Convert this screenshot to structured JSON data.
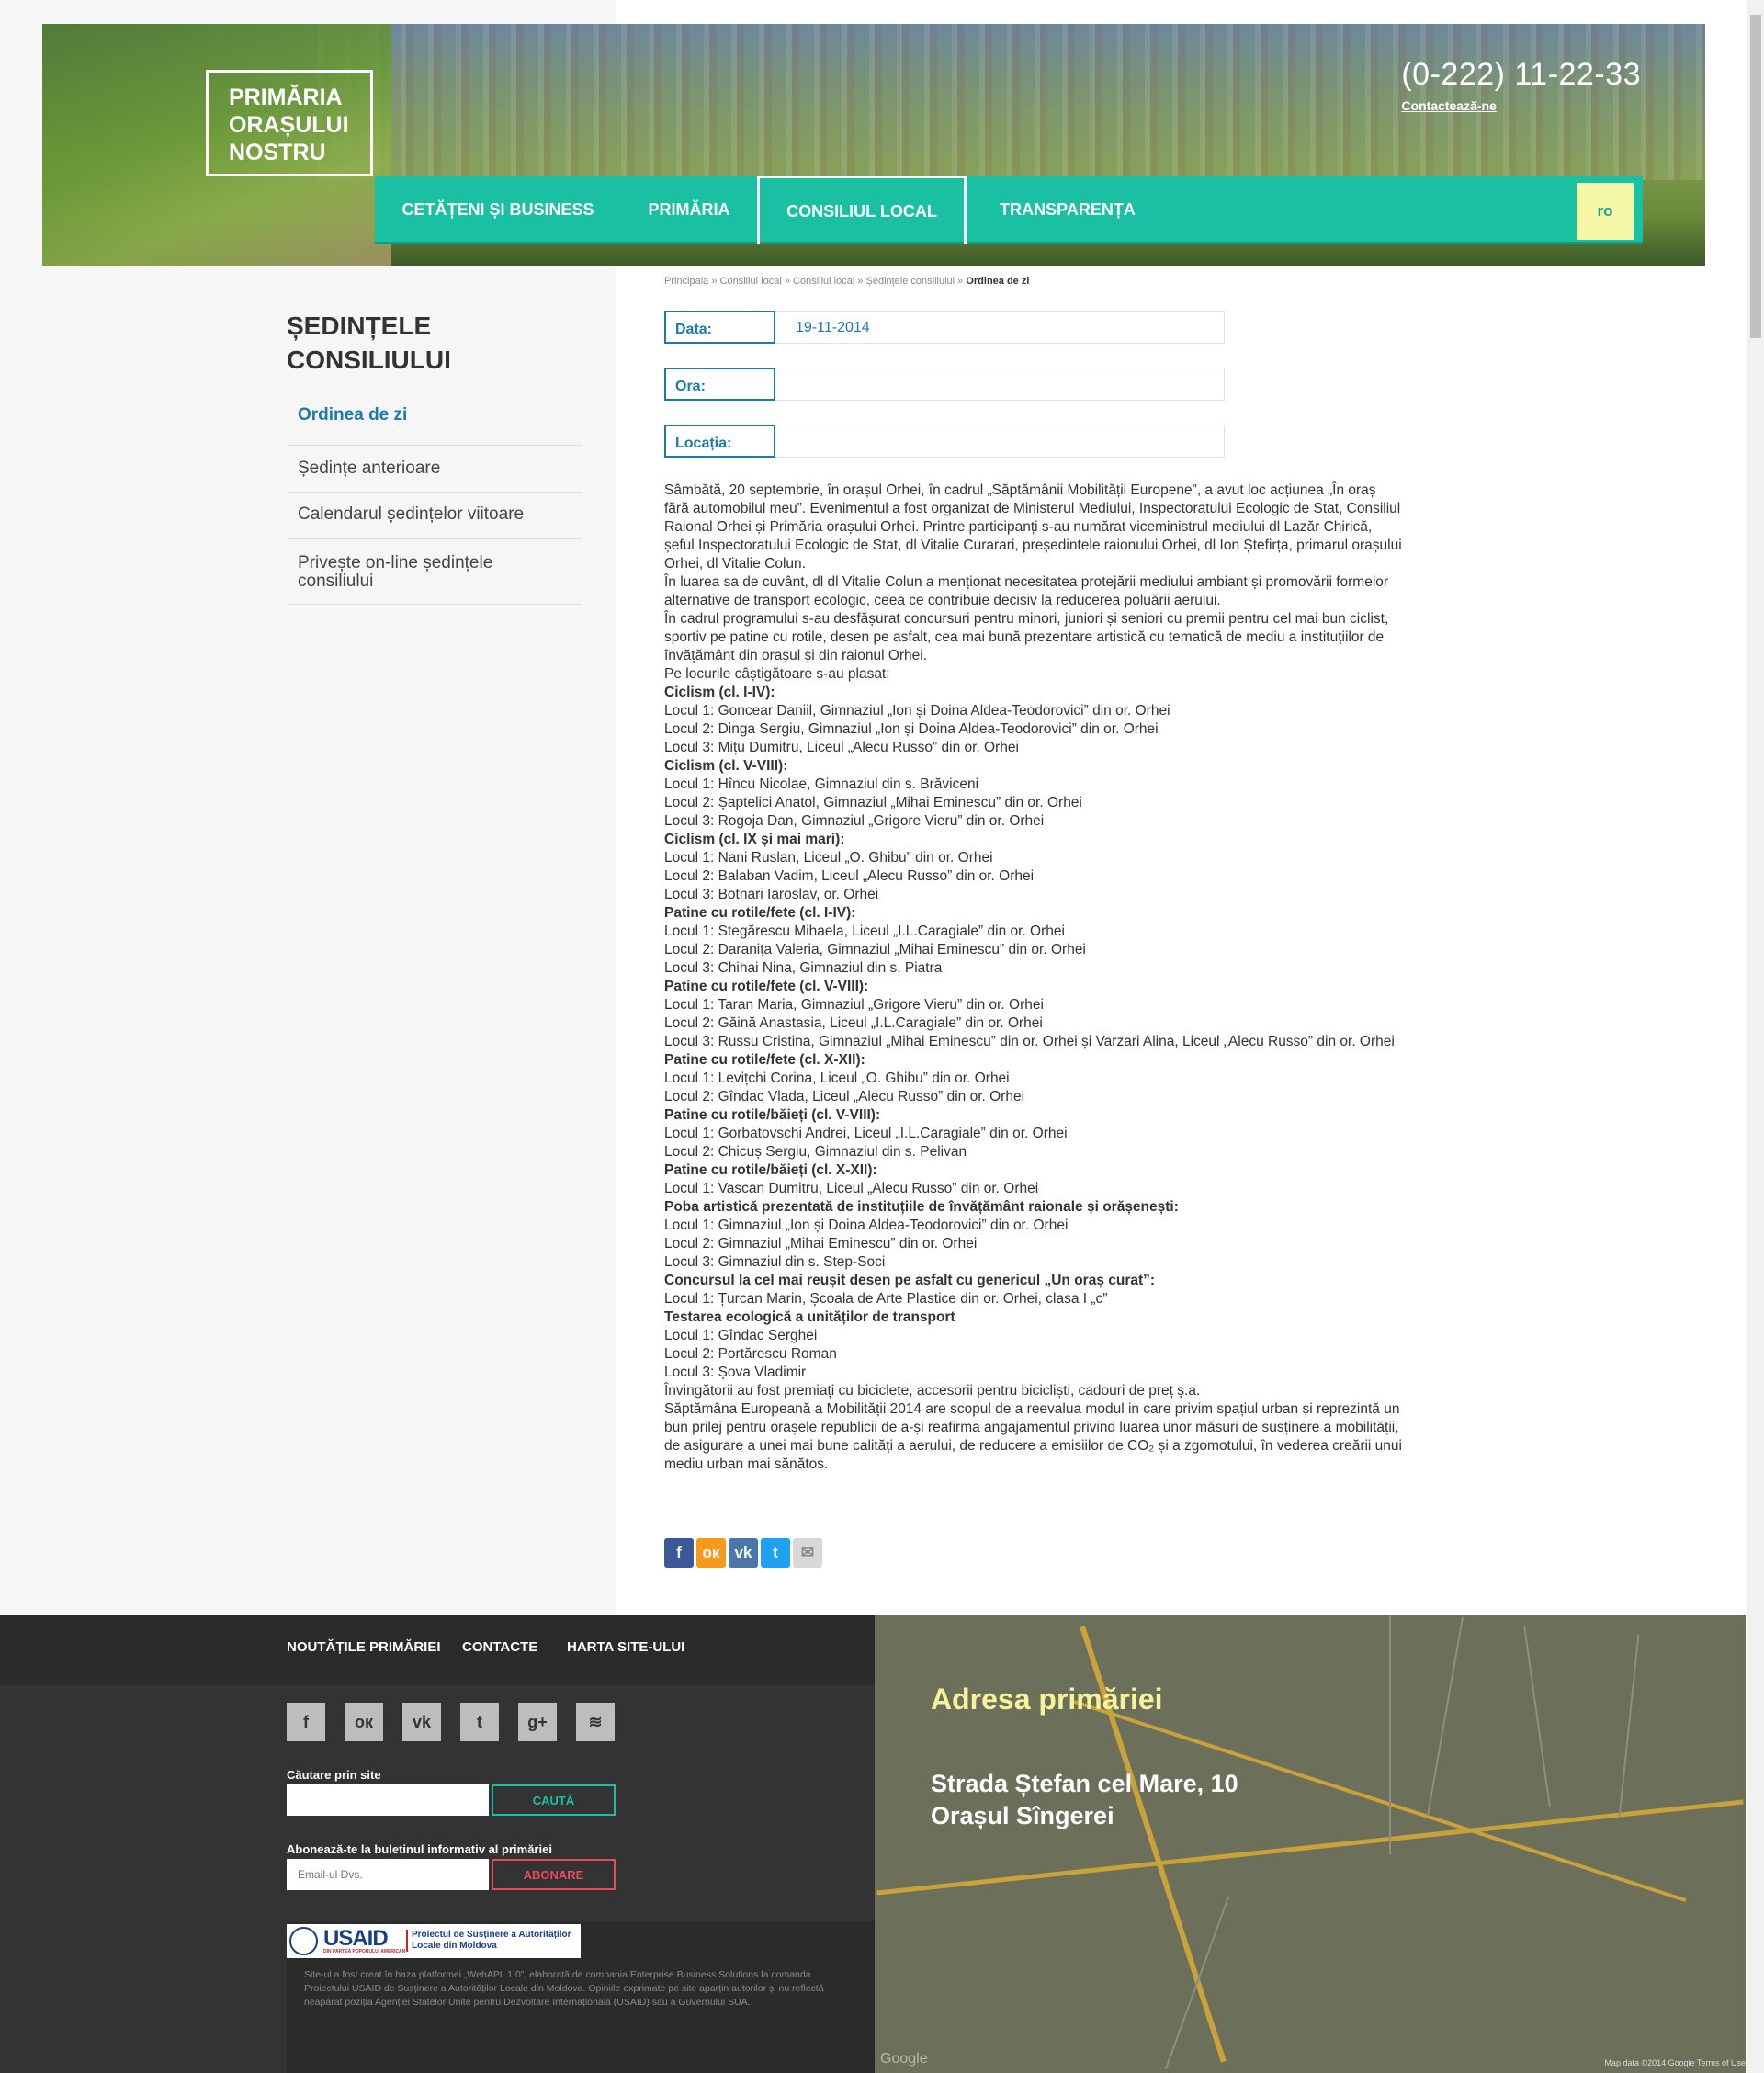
{
  "header": {
    "logo": "PRIMĂRIA\nORAȘULUI\nNOSTRU",
    "phone": "(0-222) 11-22-33",
    "contact_link": "Contactează-ne",
    "nav": [
      "CETĂȚENI ȘI BUSINESS",
      "PRIMĂRIA",
      "CONSILIUL LOCAL",
      "TRANSPARENȚA"
    ],
    "lang": "ro"
  },
  "sidebar": {
    "title": "ȘEDINȚELE CONSILIULUI",
    "items": [
      {
        "label": "Ordinea de zi",
        "active": true
      },
      {
        "label": "Ședințe anterioare"
      },
      {
        "label": "Calendarul ședințelor viitoare"
      },
      {
        "label": "Privește on-line ședințele consiliului"
      }
    ]
  },
  "breadcrumb": {
    "path": "Principala » Consiliul local » Consiliul local » Ședințele consiliului » ",
    "current": "Ordinea de zi"
  },
  "meeting": {
    "date_label": "Data:",
    "date_value": "19-11-2014",
    "time_label": "Ora:",
    "time_value": "",
    "location_label": "Locația:",
    "location_value": ""
  },
  "article": [
    {
      "t": "Sâmbătă, 20 septembrie, în orașul Orhei, în cadrul „Săptămânii Mobilității Europene”, a avut loc acțiunea „În oraș fără automobilul meu”. Evenimentul a fost organizat de Ministerul Mediului, Inspectoratului Ecologic de Stat, Consiliul Raional Orhei și Primăria orașului Orhei. Printre participanți s-au numărat viceministrul mediului dl Lazăr Chirică, șeful Inspectoratului Ecologic de Stat, dl Vitalie Curarari, președintele raionului Orhei, dl Ion Ștefirța, primarul orașului Orhei, dl Vitalie Colun."
    },
    {
      "t": "În luarea sa de cuvânt, dl  dl Vitalie Colun a menționat necesitatea protejării mediului ambiant și promovării formelor alternative de transport ecologic, ceea ce contribuie decisiv la reducerea poluării aerului."
    },
    {
      "t": "În cadrul programului s-au desfășurat concursuri pentru minori, juniori și seniori cu premii pentru cel mai bun ciclist, sportiv pe patine cu rotile, desen pe asfalt, cea mai bună prezentare artistică cu tematică de mediu a instituțiilor de învățământ din orașul și din raionul Orhei."
    },
    {
      "t": "Pe locurile câștigătoare s-au plasat:"
    },
    {
      "t": "Ciclism (cl. I-IV):",
      "b": true
    },
    {
      "t": "Locul 1: Goncear Daniil, Gimnaziul „Ion și Doina Aldea-Teodorovici” din or. Orhei"
    },
    {
      "t": "Locul 2: Dinga Sergiu, Gimnaziul „Ion și Doina Aldea-Teodorovici” din or. Orhei"
    },
    {
      "t": "Locul 3: Mițu Dumitru, Liceul „Alecu Russo” din or. Orhei"
    },
    {
      "t": "Ciclism (cl. V-VIII):",
      "b": true
    },
    {
      "t": "Locul 1: Hîncu Nicolae, Gimnaziul din s. Brăviceni"
    },
    {
      "t": "Locul 2: Șaptelici Anatol, Gimnaziul „Mihai Eminescu” din or. Orhei"
    },
    {
      "t": "Locul 3: Rogoja Dan, Gimnaziul „Grigore Vieru” din or. Orhei"
    },
    {
      "t": "Ciclism (cl. IX și mai mari):",
      "b": true
    },
    {
      "t": "Locul 1: Nani Ruslan, Liceul „O. Ghibu” din or. Orhei"
    },
    {
      "t": "Locul 2: Balaban Vadim, Liceul „Alecu Russo” din or. Orhei"
    },
    {
      "t": "Locul 3: Botnari Iaroslav, or. Orhei"
    },
    {
      "t": "Patine cu rotile/fete (cl. I-IV):",
      "b": true
    },
    {
      "t": "Locul 1: Stegărescu Mihaela, Liceul „I.L.Caragiale” din or. Orhei"
    },
    {
      "t": "Locul 2: Daranița Valeria, Gimnaziul „Mihai Eminescu” din or. Orhei"
    },
    {
      "t": "Locul 3: Chihai Nina, Gimnaziul din s. Piatra"
    },
    {
      "t": "Patine cu rotile/fete (cl. V-VIII):",
      "b": true
    },
    {
      "t": "Locul 1: Taran Maria, Gimnaziul „Grigore Vieru” din or. Orhei"
    },
    {
      "t": "Locul 2: Găină Anastasia, Liceul „I.L.Caragiale” din or. Orhei"
    },
    {
      "t": "Locul 3: Russu Cristina, Gimnaziul „Mihai Eminescu” din or. Orhei și Varzari Alina, Liceul „Alecu Russo” din or. Orhei"
    },
    {
      "t": "Patine cu rotile/fete (cl. X-XII):",
      "b": true
    },
    {
      "t": "Locul 1: Levițchi Corina, Liceul „O. Ghibu” din or. Orhei"
    },
    {
      "t": "Locul 2: Gîndac Vlada, Liceul „Alecu Russo” din or. Orhei"
    },
    {
      "t": "Patine cu rotile/băieți (cl. V-VIII):",
      "b": true
    },
    {
      "t": "Locul 1: Gorbatovschi Andrei, Liceul „I.L.Caragiale” din or. Orhei"
    },
    {
      "t": "Locul 2: Chicuș Sergiu, Gimnaziul din s. Pelivan"
    },
    {
      "t": "Patine cu rotile/băieți (cl. X-XII):",
      "b": true
    },
    {
      "t": "Locul 1: Vascan Dumitru, Liceul „Alecu Russo” din or. Orhei"
    },
    {
      "t": "Poba artistică prezentată de instituțiile de învățământ raionale și orășenești:",
      "b": true
    },
    {
      "t": "Locul 1: Gimnaziul „Ion și Doina Aldea-Teodorovici” din or. Orhei"
    },
    {
      "t": "Locul 2: Gimnaziul „Mihai Eminescu” din or. Orhei"
    },
    {
      "t": "Locul 3: Gimnaziul din s. Step-Soci"
    },
    {
      "t": "Concursul la cel mai reușit desen pe asfalt cu genericul „Un oraș curat”:",
      "b": true
    },
    {
      "t": "Locul 1: Țurcan Marin, Școala de Arte Plastice din or. Orhei, clasa I „c”"
    },
    {
      "t": "Testarea ecologică a unităților de transport",
      "b": true
    },
    {
      "t": "Locul 1: Gîndac Serghei"
    },
    {
      "t": "Locul 2: Portărescu Roman"
    },
    {
      "t": "Locul 3: Șova Vladimir"
    },
    {
      "t": "Învingătorii au fost premiați cu biciclete, accesorii pentru bicicliști, cadouri de preț ș.a."
    },
    {
      "t": "Săptămâna Europeană a Mobilității 2014 are scopul de a reevalua modul in care privim spațiul urban și reprezintă un bun prilej pentru orașele republicii de a-și reafirma angajamentul privind luarea unor măsuri de susținere a mobilității, de asigurare a unei mai bune calități a aerului, de reducere a emisiilor de CO₂ și a zgomotului, în vederea creării unui mediu urban mai sănătos."
    }
  ],
  "share": [
    {
      "icon": "facebook-icon",
      "glyph": "f",
      "color": "#3b5998"
    },
    {
      "icon": "odnoklassniki-icon",
      "glyph": "ок",
      "color": "#f59a1b"
    },
    {
      "icon": "vk-icon",
      "glyph": "vk",
      "color": "#4a76a8"
    },
    {
      "icon": "twitter-icon",
      "glyph": "t",
      "color": "#1da1f2"
    },
    {
      "icon": "email-icon",
      "glyph": "✉",
      "color": "#d8d8d8"
    }
  ],
  "footer": {
    "links": [
      "NOUTĂȚILE PRIMĂRIEI",
      "CONTACTE",
      "HARTA SITE-ULUI"
    ],
    "social": [
      {
        "icon": "facebook-icon",
        "glyph": "f"
      },
      {
        "icon": "odnoklassniki-icon",
        "glyph": "ок"
      },
      {
        "icon": "vk-icon",
        "glyph": "vk"
      },
      {
        "icon": "twitter-icon",
        "glyph": "t"
      },
      {
        "icon": "googleplus-icon",
        "glyph": "g+"
      },
      {
        "icon": "rss-icon",
        "glyph": "≋"
      }
    ],
    "search_label": "Căutare prin site",
    "search_placeholder": "",
    "search_button": "CAUTĂ",
    "newsletter_label": "Abonează-te la buletinul informativ al primăriei",
    "email_placeholder": "Email-ul Dvs.",
    "subscribe_button": "ABONARE",
    "usaid_word": "USAID",
    "usaid_sub": "DIN PARTEA POPORULUI AMERICAN",
    "usaid_project": "Proiectul de Susținere a Autorităților Locale din Moldova",
    "disclaimer": "Site-ul a fost creat în baza platformei „WebAPL 1.0”, elaborată de compania Enterprise Business Solutions la comanda Proiectului USAID de Susținere a Autorităților Locale din Moldova. Opiniile exprimate pe site aparțin autorilor și nu reflectă neapărat poziția Agenției Statelor Unite pentru Dezvoltare Internațională (USAID) sau a Guvernului SUA.",
    "address_title": "Adresa primăriei",
    "address": "Strada Ștefan cel Mare, 10\nOrașul Sîngerei",
    "map_credit": "Map data ©2014 Google   Terms of Use",
    "google": "Google"
  }
}
